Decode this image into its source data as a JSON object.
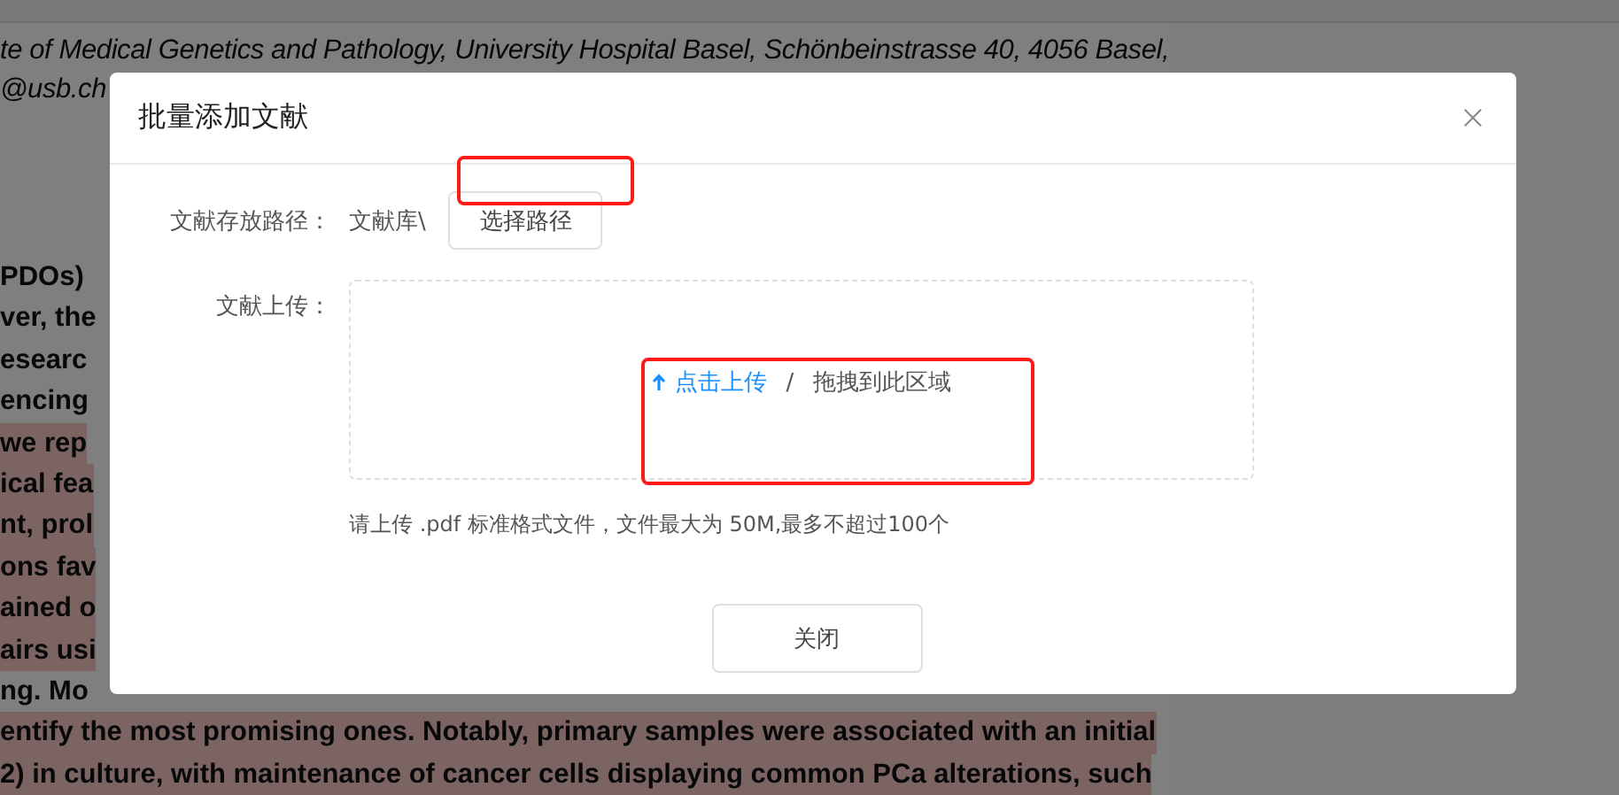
{
  "document": {
    "affiliation_lines": [
      "te of Medical Genetics and Pathology, University Hospital Basel, Schönbeinstrasse 40, 4056 Basel,",
      "@usb.ch"
    ],
    "body_lines": [
      {
        "text": "PDOs)",
        "highlighted": false
      },
      {
        "text": "ver, the",
        "highlighted": false
      },
      {
        "text": "esearc",
        "highlighted": false
      },
      {
        "text": "encing",
        "highlighted": false
      },
      {
        "text": "we rep",
        "highlighted": true
      },
      {
        "text": "ical fea",
        "highlighted": true
      },
      {
        "text": "nt, prol",
        "highlighted": true
      },
      {
        "text": "ons fav",
        "highlighted": true
      },
      {
        "text": "ained o",
        "highlighted": true
      },
      {
        "text": "airs usi",
        "highlighted": true
      },
      {
        "text": "ng. Mo",
        "highlighted": false
      },
      {
        "text": "entify the most promising ones. Notably, primary samples were associated with an initial",
        "highlighted": true
      },
      {
        "text": "2) in culture, with maintenance of cancer cells displaying common PCa alterations, such",
        "highlighted": true
      }
    ]
  },
  "dialog": {
    "title": "批量添加文献",
    "path_row": {
      "label": "文献存放路径：",
      "value": "文献库\\",
      "button": "选择路径"
    },
    "upload_row": {
      "label": "文献上传：",
      "link": "点击上传",
      "separator": "/",
      "hint": "拖拽到此区域"
    },
    "note": "请上传 .pdf 标准格式文件，文件最大为 50M,最多不超过100个",
    "buttons": [
      "关闭"
    ]
  }
}
